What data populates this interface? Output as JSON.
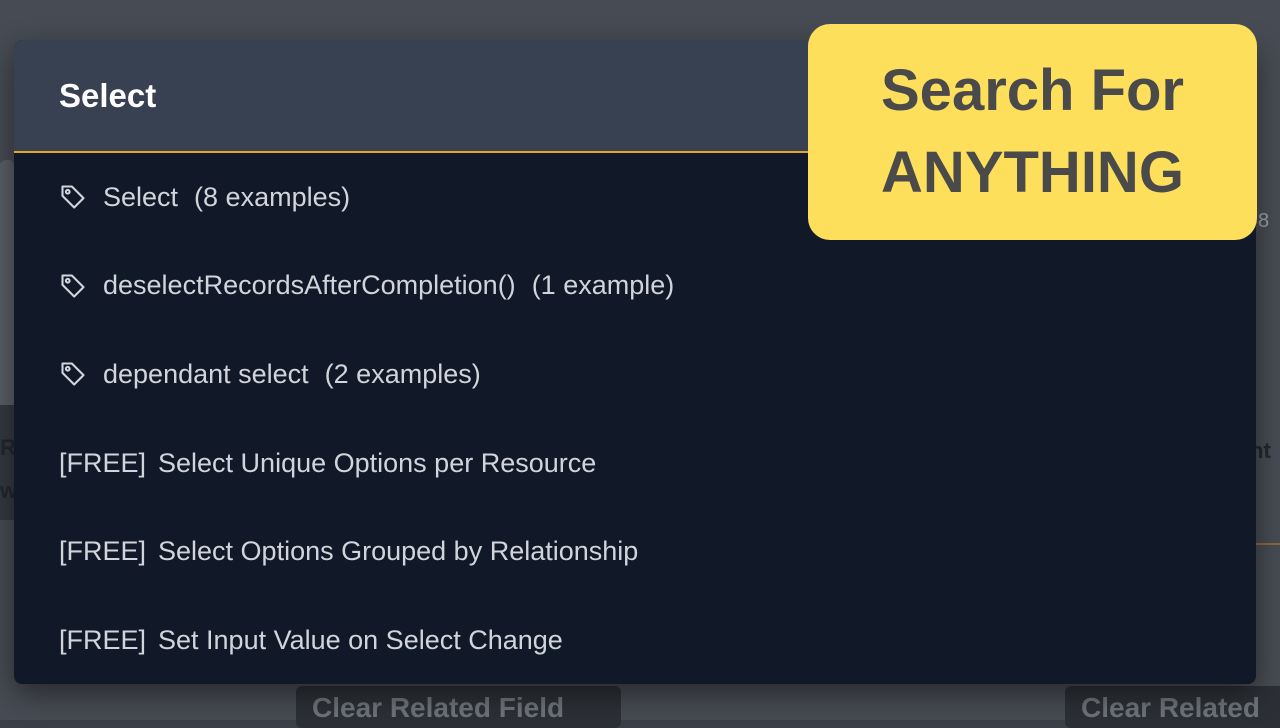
{
  "background": {
    "side_number": "8",
    "left_fragment_top": "R",
    "left_fragment_bottom": "w",
    "right_fragment": "nt",
    "buttons": [
      "Clear Related Field",
      "Clear Related"
    ]
  },
  "modal": {
    "query": "Select",
    "results": [
      {
        "type": "tag",
        "icon": "tag-icon",
        "label": "Select",
        "count": "(8 examples)"
      },
      {
        "type": "tag",
        "icon": "tag-icon",
        "label": "deselectRecordsAfterCompletion()",
        "count": "(1 example)"
      },
      {
        "type": "tag",
        "icon": "tag-icon",
        "label": "dependant select",
        "count": "(2 examples)"
      },
      {
        "type": "example",
        "prefix": "[FREE]",
        "label": "Select Unique Options per Resource"
      },
      {
        "type": "example",
        "prefix": "[FREE]",
        "label": "Select Options Grouped by Relationship"
      },
      {
        "type": "example",
        "prefix": "[FREE]",
        "label": "Set Input Value on Select Change"
      }
    ]
  },
  "callout": {
    "line1": "Search For",
    "line2": "ANYTHING"
  },
  "colors": {
    "modal_bg": "#111827",
    "header_bg": "#374151",
    "accent": "#e0a62a",
    "callout_bg": "#fddf5c"
  }
}
